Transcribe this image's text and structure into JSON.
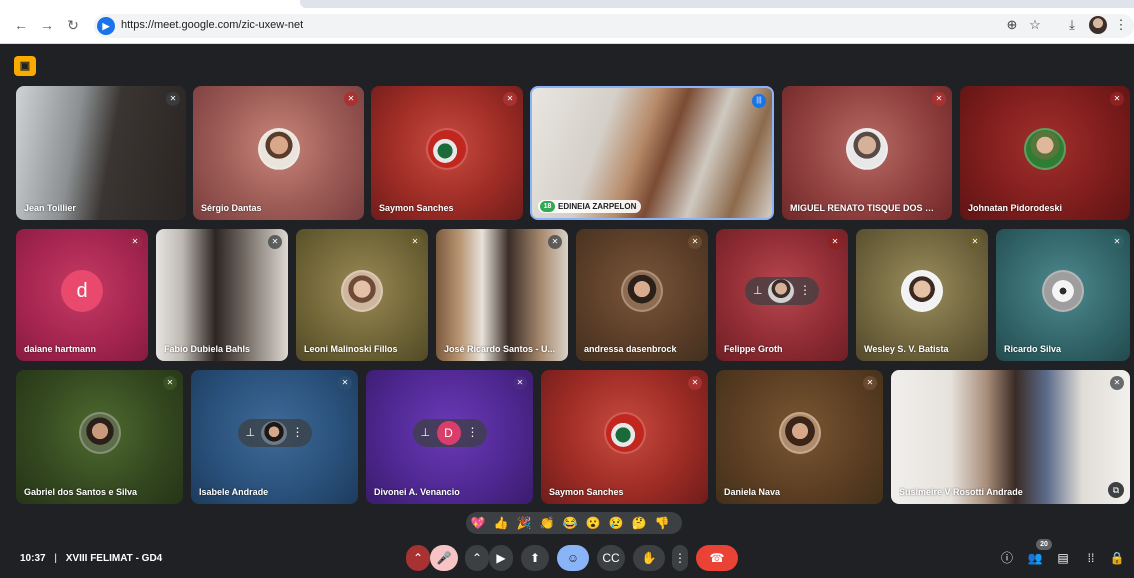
{
  "browser": {
    "url": "https://meet.google.com/zic-uxew-net",
    "icons": [
      "back-icon",
      "forward-icon",
      "reload-icon",
      "zoom-icon",
      "star-icon",
      "download-icon",
      "profile-avatar",
      "kebab-menu-icon"
    ]
  },
  "meeting": {
    "time": "10:37",
    "separator": "|",
    "title": "XVIII FELIMAT - GD4",
    "participants_count": "20"
  },
  "tiles": [
    {
      "name": "Jean Toillier"
    },
    {
      "name": "Sérgio Dantas"
    },
    {
      "name": "Saymon Sanches"
    },
    {
      "name": "EDINEIA ZARPELON",
      "badge": "18"
    },
    {
      "name": "MIGUEL RENATO TISQUE DOS S..."
    },
    {
      "name": "Johnatan Pidorodeski"
    },
    {
      "name": "daiane hartmann",
      "letter": "d"
    },
    {
      "name": "Fabio Dubiela Bahls"
    },
    {
      "name": "Leoni Malinoski Fillos"
    },
    {
      "name": "José Ricardo Santos - U..."
    },
    {
      "name": "andressa dasenbrock"
    },
    {
      "name": "Felippe Groth"
    },
    {
      "name": "Wesley S. V. Batista"
    },
    {
      "name": "Ricardo Silva"
    },
    {
      "name": "Gabriel dos Santos e Silva"
    },
    {
      "name": "Isabele Andrade"
    },
    {
      "name": "Divonei A. Venancio",
      "letter": "D"
    },
    {
      "name": "Saymon Sanches"
    },
    {
      "name": "Daniela Nava"
    },
    {
      "name": "Susimeire V Rosotti Andrade"
    }
  ],
  "reactions": [
    "💖",
    "👍",
    "🎉",
    "👏",
    "😂",
    "😮",
    "😢",
    "🤔",
    "👎"
  ],
  "colors": {
    "stage": "#202124",
    "end_call": "#ea4335",
    "accent": "#8ab4f8",
    "badge": "#f9ab00"
  }
}
